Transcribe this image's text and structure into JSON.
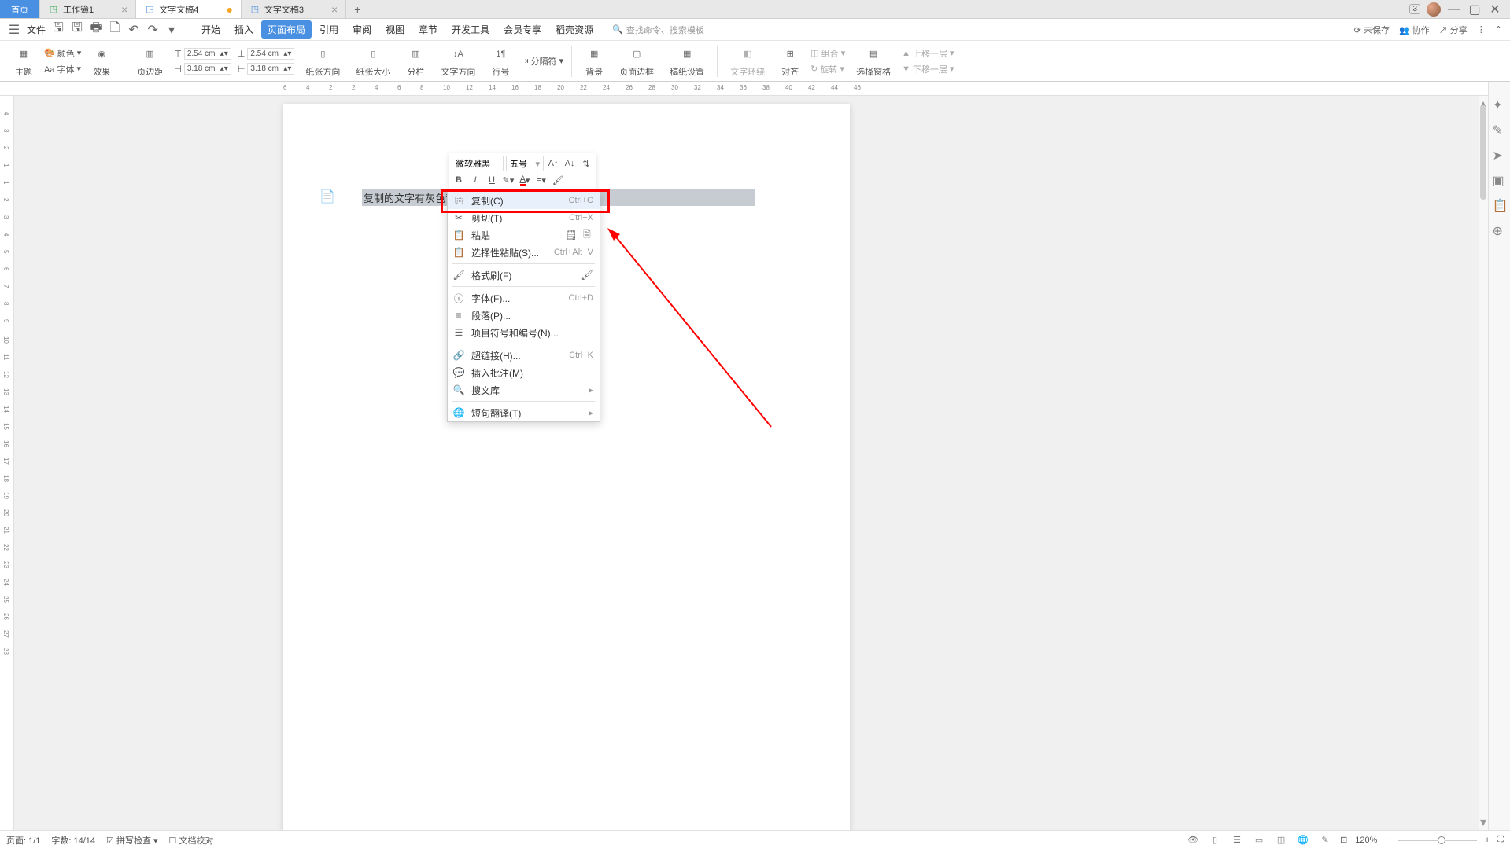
{
  "tabs": {
    "home": "首页",
    "items": [
      {
        "icon": "S",
        "label": "工作簿1",
        "modified": false
      },
      {
        "icon": "W",
        "label": "文字文稿4",
        "modified": true,
        "active": true
      },
      {
        "icon": "W",
        "label": "文字文稿3",
        "modified": false
      }
    ],
    "badge": "3"
  },
  "menu": {
    "file": "文件",
    "items": [
      "开始",
      "插入",
      "页面布局",
      "引用",
      "审阅",
      "视图",
      "章节",
      "开发工具",
      "会员专享",
      "稻壳资源"
    ],
    "active_index": 2,
    "search_prompt": "查找命令、搜索模板",
    "right": {
      "unsaved": "未保存",
      "collab": "协作",
      "share": "分享"
    }
  },
  "ribbon": {
    "theme": "主题",
    "color": "颜色",
    "font": "Aa 字体",
    "effect": "效果",
    "margin_label": "页边距",
    "margins": {
      "top": "2.54 cm",
      "bottom": "2.54 cm",
      "left": "3.18 cm",
      "right": "3.18 cm"
    },
    "orientation": "纸张方向",
    "size": "纸张大小",
    "columns": "分栏",
    "text_dir": "文字方向",
    "line_num": "行号",
    "breaks": "分隔符",
    "bg": "背景",
    "border": "页面边框",
    "paper_setup": "稿纸设置",
    "wrap": "文字环绕",
    "align": "对齐",
    "group": "组合",
    "rotate": "旋转",
    "sel_pane": "选择窗格",
    "up_one": "上移一层",
    "down_one": "下移一层"
  },
  "ruler_h": [
    -6,
    -4,
    -2,
    2,
    4,
    6,
    8,
    10,
    12,
    14,
    16,
    18,
    20,
    22,
    24,
    26,
    28,
    30,
    32,
    34,
    36,
    38,
    40,
    42,
    44,
    46
  ],
  "ruler_v": [
    -4,
    -3,
    -2,
    -1,
    1,
    2,
    3,
    4,
    5,
    6,
    7,
    8,
    9,
    10,
    11,
    12,
    13,
    14,
    15,
    16,
    17,
    18,
    19,
    20,
    21,
    22,
    23,
    24,
    25,
    26,
    27,
    28
  ],
  "document": {
    "selected_text": "复制的文字有灰色背景怎么去除"
  },
  "mini_toolbar": {
    "font": "微软雅黑",
    "size": "五号"
  },
  "context_menu": [
    {
      "icon": "copy",
      "label": "复制(C)",
      "shortcut": "Ctrl+C",
      "hl": true
    },
    {
      "icon": "cut",
      "label": "剪切(T)",
      "shortcut": "Ctrl+X"
    },
    {
      "icon": "paste",
      "label": "粘贴",
      "extra": true
    },
    {
      "icon": "paste-special",
      "label": "选择性粘贴(S)...",
      "shortcut": "Ctrl+Alt+V"
    },
    {
      "sep": true
    },
    {
      "icon": "format-painter",
      "label": "格式刷(F)",
      "extra_single": true
    },
    {
      "sep": true
    },
    {
      "icon": "font",
      "label": "字体(F)...",
      "shortcut": "Ctrl+D"
    },
    {
      "icon": "para",
      "label": "段落(P)..."
    },
    {
      "icon": "bullets",
      "label": "项目符号和编号(N)..."
    },
    {
      "sep": true
    },
    {
      "icon": "link",
      "label": "超链接(H)...",
      "shortcut": "Ctrl+K"
    },
    {
      "icon": "comment",
      "label": "插入批注(M)"
    },
    {
      "icon": "search-lib",
      "label": "搜文库",
      "sub": true
    },
    {
      "sep": true
    },
    {
      "icon": "translate",
      "label": "短句翻译(T)",
      "sub": true
    }
  ],
  "status": {
    "page": "页面: 1/1",
    "words": "字数: 14/14",
    "spell": "拼写检查",
    "proof": "文档校对",
    "zoom": "120%"
  }
}
